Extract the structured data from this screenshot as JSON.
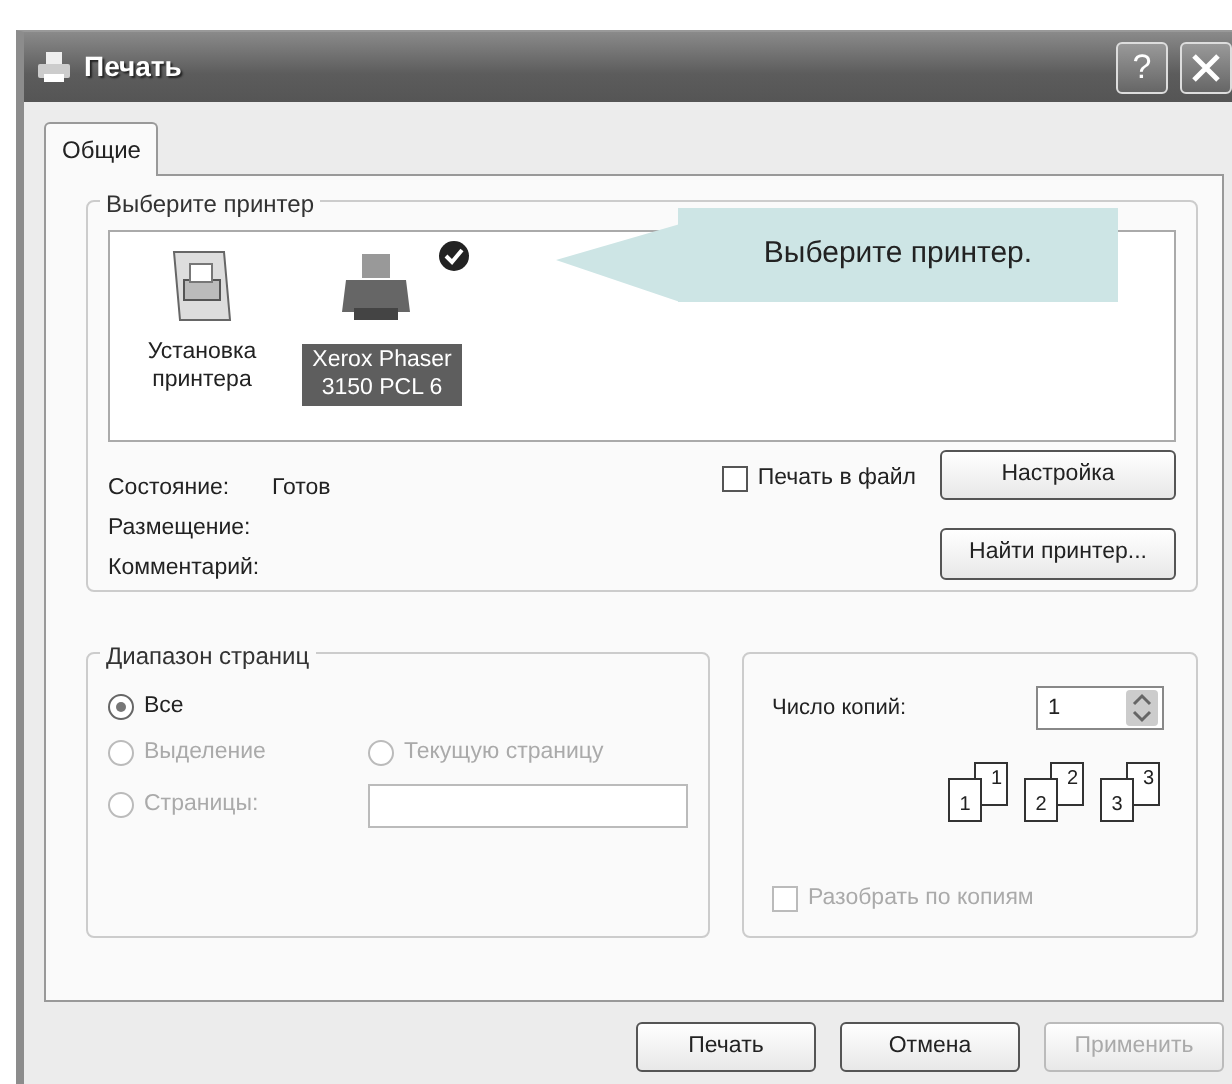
{
  "window": {
    "title": "Печать",
    "help_button": "?"
  },
  "tabs": [
    {
      "label": "Общие",
      "selected": true
    }
  ],
  "printer_group": {
    "title": "Выберите принтер",
    "printers": [
      {
        "label": "Установка принтера",
        "kind": "add",
        "selected": false,
        "default": false
      },
      {
        "label": "Xerox Phaser 3150 PCL 6",
        "kind": "printer",
        "selected": true,
        "default": true
      }
    ],
    "info": [
      {
        "label": "Состояние:",
        "value": "Готов"
      },
      {
        "label": "Размещение:"
      },
      {
        "label": "Комментарий:"
      }
    ],
    "print_to_file": {
      "label": "Печать в файл",
      "checked": false
    },
    "buttons": [
      "Настройка",
      "Найти принтер..."
    ]
  },
  "callout": {
    "text": "Выберите принтер."
  },
  "page_range": {
    "title": "Диапазон страниц",
    "options": [
      {
        "label": "Все",
        "selected": true,
        "disabled": false
      },
      {
        "label": "Выделение",
        "selected": false,
        "disabled": true
      },
      {
        "label": "Текущую страницу",
        "selected": false,
        "disabled": true
      },
      {
        "label": "Страницы:",
        "selected": false,
        "disabled": true
      }
    ],
    "pages_field": {
      "disabled": true
    }
  },
  "copies": {
    "label": "Число копий:",
    "value": "1",
    "collate_pages": [
      {
        "back": "1",
        "front": "1"
      },
      {
        "back": "2",
        "front": "2"
      },
      {
        "back": "3",
        "front": "3"
      }
    ],
    "collate": {
      "label": "Разобрать по копиям",
      "checked": false,
      "disabled": true
    }
  },
  "dialog_buttons": [
    {
      "label": "Печать",
      "disabled": false
    },
    {
      "label": "Отмена",
      "disabled": false
    },
    {
      "label": "Применить",
      "disabled": true
    }
  ]
}
